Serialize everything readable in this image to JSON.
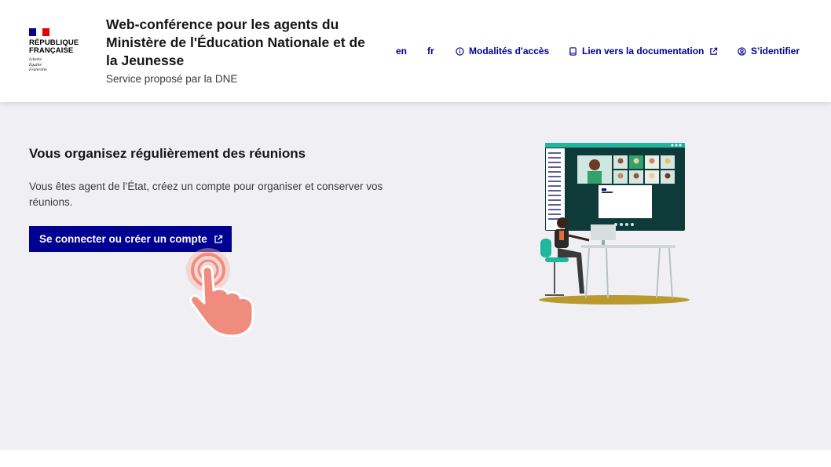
{
  "logo": {
    "line1": "RÉPUBLIQUE",
    "line2": "FRANÇAISE",
    "motto1": "Liberté",
    "motto2": "Égalité",
    "motto3": "Fraternité"
  },
  "service": {
    "title": "Web-conférence pour les agents du Ministère de l'Éducation Nationale et de la Jeunesse",
    "tagline": "Service proposé par la DNE"
  },
  "tools": {
    "lang_en": "en",
    "lang_fr": "fr",
    "access": "Modalités d'accès",
    "docs": "Lien vers la documentation",
    "login": "S’identifier"
  },
  "main": {
    "heading": "Vous organisez régulièrement des réunions",
    "description": "Vous êtes agent de l’État, créez un compte pour organiser et conserver vos réunions.",
    "cta_label": "Se connecter ou créer un compte"
  },
  "colors": {
    "primary": "#000091",
    "background": "#f0f0f4",
    "hand": "#f08c7e"
  },
  "icons": [
    "info-icon",
    "book-icon",
    "external-link-icon",
    "user-icon",
    "pointing-hand-icon"
  ]
}
